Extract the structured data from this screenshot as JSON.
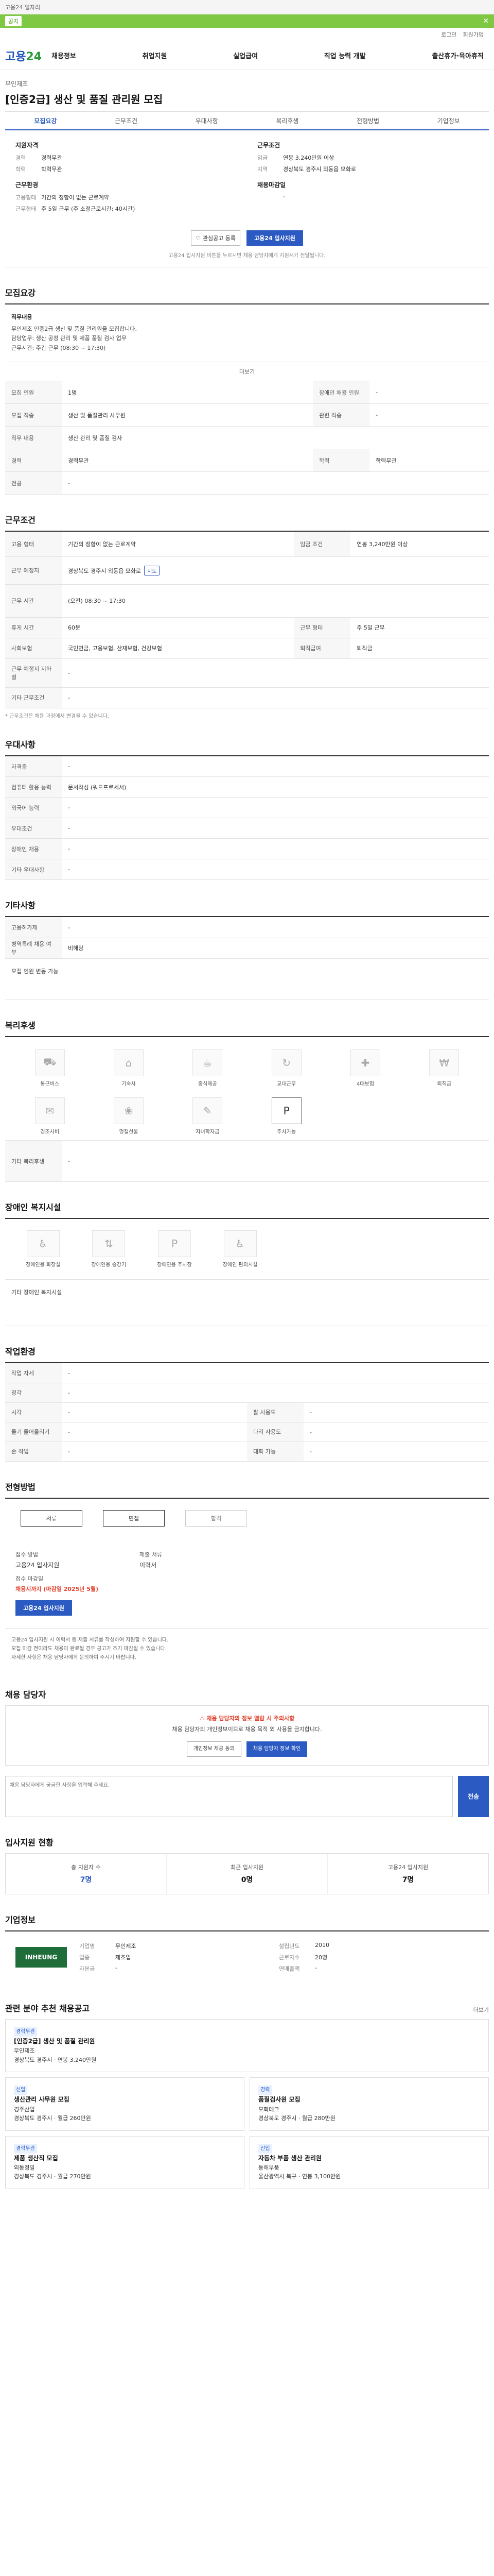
{
  "topband": {
    "text": "고용24 일자리"
  },
  "greenbar": {
    "button": "공지",
    "text": "",
    "close": "✕"
  },
  "utility": {
    "items": [
      "로그인",
      "회원가입"
    ]
  },
  "header": {
    "logo_main": "고용",
    "logo_sub": "24",
    "nav": [
      "채용정보",
      "취업지원",
      "실업급여",
      "직업 능력 개발",
      "출산휴가·육아휴직"
    ]
  },
  "job": {
    "company": "무인제조",
    "title": "[인증2급] 생산 및 품질 관리원 모집",
    "tabs": [
      "모집요강",
      "근무조건",
      "우대사항",
      "복리후생",
      "전형방법",
      "기업정보"
    ]
  },
  "summary": {
    "left_heading": "지원자격",
    "left": [
      {
        "k": "경력",
        "v": "경력무관"
      },
      {
        "k": "학력",
        "v": "학력무관"
      }
    ],
    "left_heading2": "근무환경",
    "left2": [
      {
        "k": "고용형태",
        "v": "기간의 정함이 없는 근로계약"
      },
      {
        "k": "근무형태",
        "v": "주 5일 근무 (주 소정근로시간: 40시간)"
      }
    ],
    "right_heading": "근무조건",
    "right": [
      {
        "k": "임금",
        "v": "연봉 3,240만원 이상"
      },
      {
        "k": "지역",
        "v": "경상북도 경주시 외동읍 모화로"
      },
      {
        "k": "",
        "v": ""
      }
    ],
    "right_heading2": "채용마감일",
    "right2": [
      {
        "k": "",
        "v": ""
      }
    ],
    "btn_scrap": "관심공고 등록",
    "btn_apply": "고용24 입사지원",
    "notice": "고용24 입사지원 버튼을 누르시면 채용 담당자에게 지원서가 전달됩니다."
  },
  "recruit": {
    "title": "모집요강",
    "intro_h": "직무내용",
    "intro_lines": [
      "무인제조 인증2급 생산 및 품질 관리원을 모집합니다.",
      "담당업무: 생산 공정 관리 및 제품 품질 검사 업무",
      "근무시간: 주간 근무 (08:30 ~ 17:30)"
    ],
    "more": "더보기",
    "rows": [
      {
        "k": "모집 인원",
        "v": "1명",
        "k2": "장애인 채용 인원",
        "v2": "-"
      },
      {
        "k": "모집 직종",
        "v": "생산 및 품질관리 사무원",
        "k2": "관련 직종",
        "v2": "-"
      },
      {
        "k": "직무 내용",
        "v": "생산 관리 및 품질 검사",
        "k2": "",
        "v2": ""
      },
      {
        "k": "경력",
        "v": "경력무관",
        "k2": "학력",
        "v2": "학력무관"
      },
      {
        "k": "전공",
        "v": "-",
        "k2": "",
        "v2": ""
      }
    ]
  },
  "conditions": {
    "title": "근무조건",
    "rows": [
      {
        "k": "고용 형태",
        "v": "기간의 정함이 없는 근로계약",
        "k2": "임금 조건",
        "v2": "연봉 3,240만원 이상"
      },
      {
        "k": "근무 예정지",
        "v": "경상북도 경주시 외동읍 모화로",
        "k2": "",
        "v2": ""
      },
      {
        "k": "근무 시간",
        "v": "(오전) 08:30 ~ 17:30",
        "k2": "",
        "v2": ""
      },
      {
        "k": "휴게 시간",
        "v": "60분",
        "k2": "근무 형태",
        "v2": "주 5일 근무"
      },
      {
        "k": "사회보험",
        "v": "국민연금, 고용보험, 산재보험, 건강보험",
        "k2": "퇴직급여",
        "v2": "퇴직금"
      },
      {
        "k": "근무 예정지 지하철",
        "v": "-",
        "k2": "",
        "v2": ""
      },
      {
        "k": "기타 근무조건",
        "v": "-",
        "k2": "",
        "v2": ""
      }
    ],
    "note": "* 근무조건은 채용 과정에서 변경될 수 있습니다."
  },
  "preference": {
    "title": "우대사항",
    "rows": [
      {
        "k": "자격증",
        "v": "-"
      },
      {
        "k": "컴퓨터 활용 능력",
        "v": "문서작성 (워드프로세서)"
      },
      {
        "k": "외국어 능력",
        "v": "-"
      },
      {
        "k": "우대조건",
        "v": "-"
      },
      {
        "k": "장애인 채용",
        "v": "-"
      },
      {
        "k": "기타 우대사항",
        "v": "-"
      }
    ]
  },
  "others": {
    "title": "기타사항",
    "rows": [
      {
        "k": "고용허가제",
        "v": "-"
      },
      {
        "k": "병역특례 채용 여부",
        "v": "비해당"
      }
    ],
    "foot": "모집 인원 변동 가능"
  },
  "welfare": {
    "title": "복리후생",
    "items": [
      "통근버스",
      "기숙사",
      "중식제공",
      "교대근무",
      "4대보험",
      "퇴직금",
      "경조사비",
      "명절선물",
      "자녀학자금",
      "주차가능"
    ],
    "on_index": 9,
    "foot_k": "기타 복리후생",
    "foot_v": "-"
  },
  "disabled": {
    "title": "장애인 복지시설",
    "items": [
      "장애인용 화장실",
      "장애인용 승강기",
      "장애인용 주차장",
      "장애인 편의시설"
    ],
    "foot": "기타 장애인 복지시설"
  },
  "workenv": {
    "title": "작업환경",
    "rows": [
      {
        "k": "작업 자세",
        "v": "-",
        "k2": "",
        "v2": ""
      },
      {
        "k": "청각",
        "v": "-",
        "k2": "",
        "v2": ""
      },
      {
        "k": "시각",
        "v": "-",
        "k2": "팔 사용도",
        "v2": "-"
      },
      {
        "k": "들기 들어올리기",
        "v": "-",
        "k2": "다리 사용도",
        "v2": "-"
      },
      {
        "k": "손 작업",
        "v": "-",
        "k2": "대화 가능",
        "v2": "-"
      }
    ]
  },
  "process": {
    "title": "전형방법",
    "steps": [
      "서류",
      "면접",
      "합격"
    ],
    "on": [
      true,
      true,
      false
    ]
  },
  "apply": {
    "method_label": "접수 방법",
    "method": "고용24 입사지원",
    "deadline_label": "접수 마감일",
    "deadline": "채용시까지 (마감일 2025년 5월)",
    "doc_label": "제출 서류",
    "doc": "이력서",
    "btn": "고용24 입사지원"
  },
  "apply_notes": [
    "고용24 입사지원 시 이력서 등 제출 서류를 작성하여 지원할 수 있습니다.",
    "모집 마감 전이라도 채용이 완료될 경우 공고가 조기 마감될 수 있습니다.",
    "자세한 사항은 채용 담당자에게 문의하여 주시기 바랍니다."
  ],
  "manager": {
    "title": "채용 담당자",
    "warn_title": "채용 담당자의 정보 열람 시 주의사항",
    "warn_text": "채용 담당자의 개인정보이므로 채용 목적 외 사용을 금지합니다.",
    "btn1": "개인정보 제공 동의",
    "btn2": "채용 담당자 정보 확인",
    "question_placeholder": "채용 담당자에게 궁금한 사항을 입력해 주세요.",
    "send": "전송"
  },
  "stats": {
    "title": "입사지원 현황",
    "items": [
      {
        "label": "총 지원자 수",
        "value": "7명"
      },
      {
        "label": "최근 입사지원",
        "value": "0명"
      },
      {
        "label": "고용24 입사지원",
        "value": "7명"
      }
    ]
  },
  "corp": {
    "title": "기업정보",
    "logo": "INHEUNG",
    "info": [
      {
        "k": "기업명",
        "v": "무인제조"
      },
      {
        "k": "설립년도",
        "v": "2010"
      },
      {
        "k": "업종",
        "v": "제조업"
      },
      {
        "k": "근로자수",
        "v": "20명"
      },
      {
        "k": "자본금",
        "v": "-"
      },
      {
        "k": "연매출액",
        "v": "-"
      }
    ]
  },
  "related": {
    "title": "관련 분야 추천 채용공고",
    "more": "더보기",
    "cards": [
      {
        "tag": "경력무관",
        "title": "[인증2급] 생산 및 품질 관리원",
        "co": "무인제조",
        "info": "경상북도 경주시 · 연봉 3,240만원"
      },
      {
        "tag": "신입",
        "title": "생산관리 사무원 모집",
        "co": "경주산업",
        "info": "경상북도 경주시 · 월급 260만원"
      },
      {
        "tag": "경력",
        "title": "품질검사원 모집",
        "co": "모화테크",
        "info": "경상북도 경주시 · 월급 280만원"
      },
      {
        "tag": "경력무관",
        "title": "제품 생산직 모집",
        "co": "외동정밀",
        "info": "경상북도 경주시 · 월급 270만원"
      },
      {
        "tag": "신입",
        "title": "자동차 부품 생산 관리원",
        "co": "동해부품",
        "info": "울산광역시 북구 · 연봉 3,100만원"
      }
    ]
  }
}
